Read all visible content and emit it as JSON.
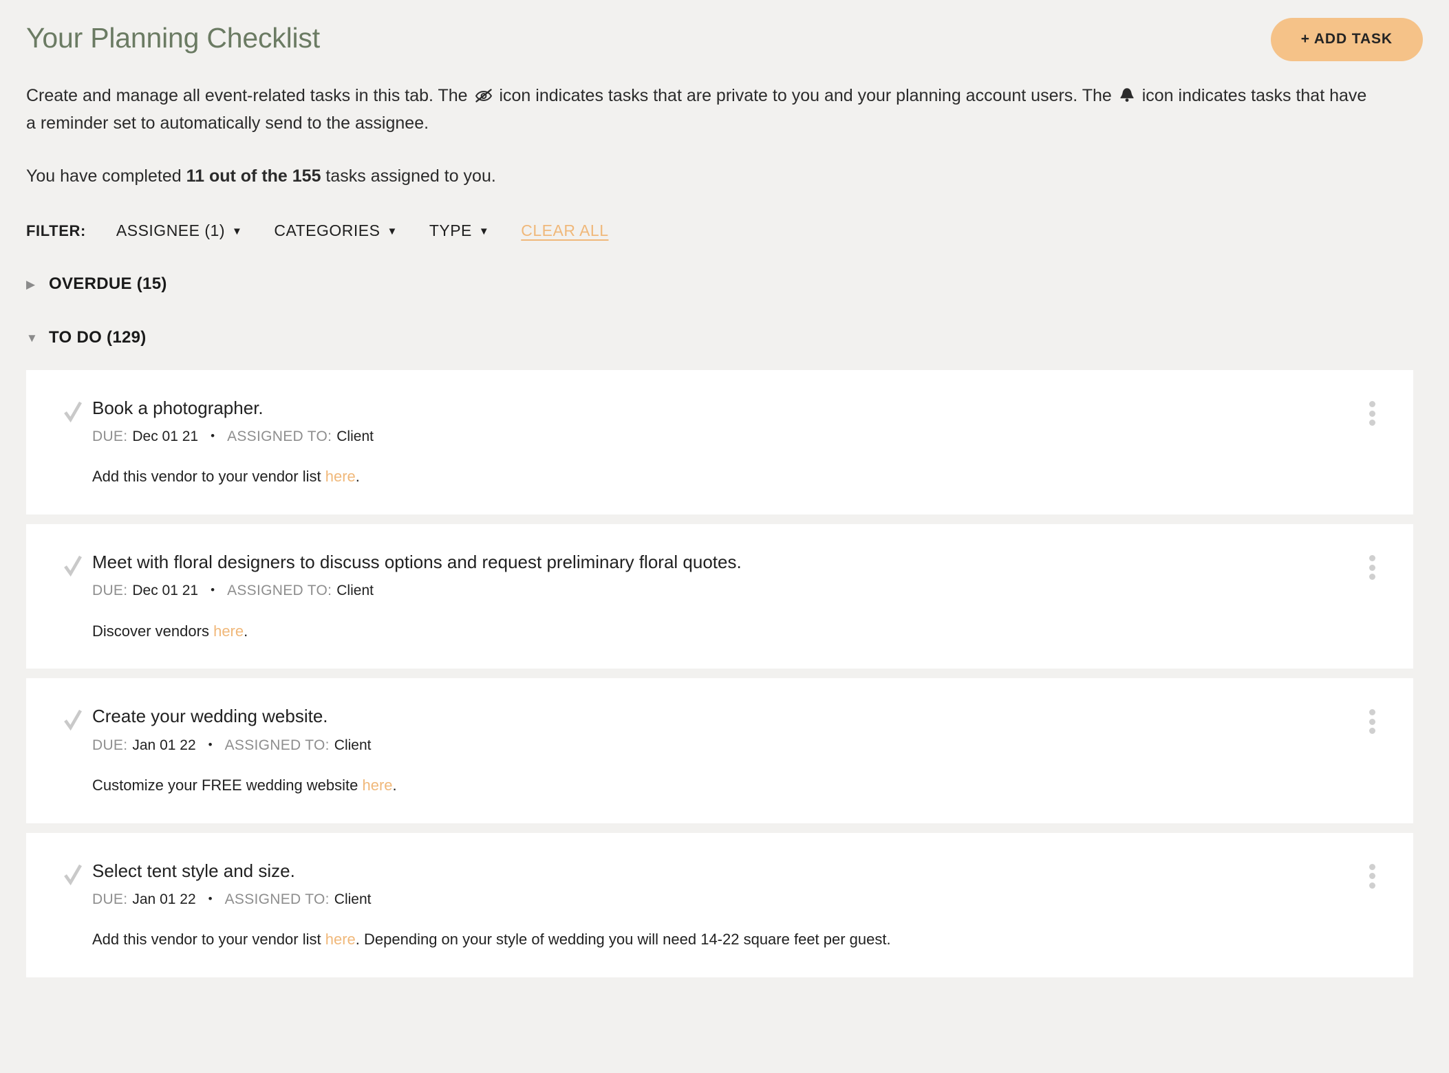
{
  "header": {
    "title": "Your Planning Checklist",
    "add_task_label": "+ ADD TASK"
  },
  "intro": {
    "part1": "Create and manage all event-related tasks in this tab. The ",
    "icon_private": "eye-slash-icon",
    "part2": " icon indicates tasks that are private to you and your planning account users. The ",
    "icon_reminder": "bell-icon",
    "part3": " icon indicates tasks that have a reminder set to automatically send to the assignee."
  },
  "stats": {
    "prefix": "You have completed ",
    "highlight": "11 out of the 155",
    "suffix": " tasks assigned to you."
  },
  "filter": {
    "label": "FILTER:",
    "items": [
      {
        "label": "ASSIGNEE (1)",
        "caret": "▼"
      },
      {
        "label": "CATEGORIES",
        "caret": "▼"
      },
      {
        "label": "TYPE",
        "caret": "▼"
      }
    ],
    "clear_all": "CLEAR ALL"
  },
  "sections": [
    {
      "title": "OVERDUE (15)",
      "arrow": "▶",
      "expanded": false
    },
    {
      "title": "TO DO (129)",
      "arrow": "▼",
      "expanded": true
    }
  ],
  "labels": {
    "due": "DUE:",
    "assigned_to": "ASSIGNED TO:",
    "separator": "•"
  },
  "tasks": [
    {
      "title": "Book a photographer.",
      "due": "Dec 01 21",
      "assignee": "Client",
      "note_before": "Add this vendor to your vendor list ",
      "note_link": "here",
      "note_after": "."
    },
    {
      "title": "Meet with floral designers to discuss options and request preliminary floral quotes.",
      "due": "Dec 01 21",
      "assignee": "Client",
      "note_before": "Discover vendors ",
      "note_link": "here",
      "note_after": "."
    },
    {
      "title": "Create your wedding website.",
      "due": "Jan 01 22",
      "assignee": "Client",
      "note_before": "Customize your FREE wedding website ",
      "note_link": "here",
      "note_after": "."
    },
    {
      "title": "Select tent style and size.",
      "due": "Jan 01 22",
      "assignee": "Client",
      "note_before": "Add this vendor to your vendor list ",
      "note_link": "here",
      "note_after": ". Depending on your style of wedding you will need 14-22 square feet per guest."
    }
  ],
  "colors": {
    "page_background": "#f2f1ef",
    "card_background": "#ffffff",
    "title_green": "#6b7b63",
    "accent_peach": "#f5c288",
    "link_orange": "#f0b87a",
    "check_gray": "#c9c9c9",
    "muted_gray": "#8e8e8e",
    "text_dark": "#212121"
  }
}
